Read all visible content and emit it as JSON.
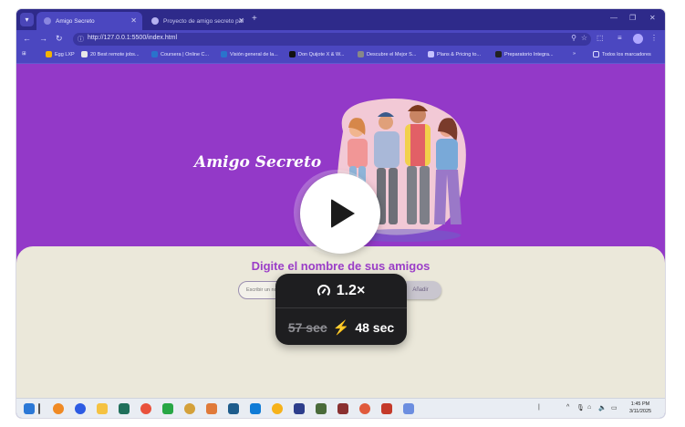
{
  "browser": {
    "tabs": [
      {
        "label": "Amigo Secreto"
      },
      {
        "label": "Proyecto de amigo secreto par"
      }
    ],
    "address": {
      "url": "http://127.0.0.1:5500/index.html"
    },
    "bookmarks": [
      {
        "label": "Egg LXP"
      },
      {
        "label": "20 Best remote jobs..."
      },
      {
        "label": "Coursera | Online C..."
      },
      {
        "label": "Visión general de la..."
      },
      {
        "label": "Don Quijote X & W..."
      },
      {
        "label": "Descubre el Mejor S..."
      },
      {
        "label": "Plans & Pricing to..."
      },
      {
        "label": "Preparatorio Integra..."
      }
    ],
    "all_bookmarks_label": "Todos los marcadores"
  },
  "page": {
    "hero_title": "Amigo Secreto",
    "section_title": "Digite el nombre de sus amigos",
    "name_input_placeholder": "Escribir un nombre",
    "add_button_label": "Añadir"
  },
  "video_overlay": {
    "speed": "1.2×",
    "original_duration": "57 sec",
    "new_duration": "48 sec"
  },
  "taskbar": {
    "time": "1:45 PM",
    "date": "3/11/2025"
  },
  "colors": {
    "page_purple": "#9339c8",
    "lower_panel": "#ebe8da",
    "title_purple": "#9b3ec8",
    "browser_chrome": "#4b47c0"
  }
}
